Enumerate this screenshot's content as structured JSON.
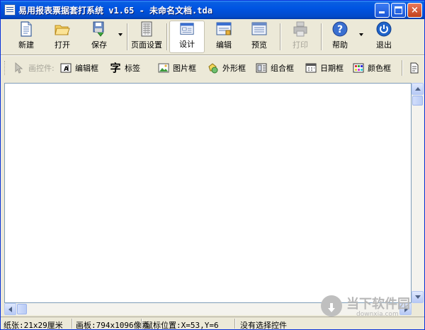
{
  "window": {
    "title": "易用报表票据套打系统 v1.65 - 未命名文档.tda",
    "controls": {
      "minimize": "minimize",
      "maximize": "maximize",
      "close": "×"
    }
  },
  "toolbar": {
    "new_label": "新建",
    "open_label": "打开",
    "save_label": "保存",
    "page_setup_label": "页面设置",
    "design_label": "设计",
    "edit_label": "编辑",
    "preview_label": "预览",
    "print_label": "打印",
    "help_label": "帮助",
    "exit_label": "退出"
  },
  "controls_toolbar": {
    "draw_label": "画控件:",
    "edit_box_label": "编辑框",
    "label_label": "标签",
    "label_glyph": "字",
    "image_box_label": "图片框",
    "shape_box_label": "外形框",
    "combo_box_label": "组合框",
    "date_box_label": "日期框",
    "color_box_label": "颜色框"
  },
  "statusbar": {
    "paper": "纸张:21x29厘米",
    "canvas": "画板:794x1096像素",
    "mouse": "鼠标位置:X=53,Y=6",
    "selection": "没有选择控件"
  },
  "watermark": {
    "text": "当下软件园",
    "url": "downxia.com"
  },
  "colors": {
    "titlebar": "#0054e3",
    "window_bg": "#ece9d8",
    "canvas_bg": "#ffffff",
    "disabled_text": "#a7a59a"
  }
}
